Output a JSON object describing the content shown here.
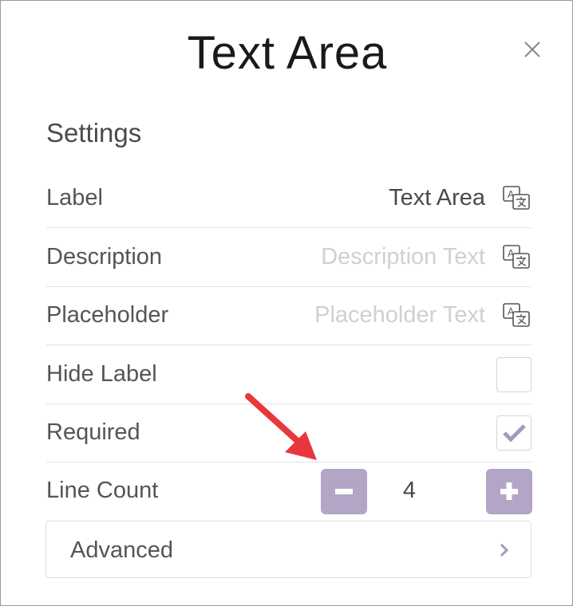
{
  "dialog": {
    "title": "Text Area",
    "section_heading": "Settings"
  },
  "rows": [
    {
      "label": "Label",
      "value": "Text Area",
      "value_is_placeholder": false
    },
    {
      "label": "Description",
      "value": "Description Text",
      "value_is_placeholder": true
    },
    {
      "label": "Placeholder",
      "value": "Placeholder Text",
      "value_is_placeholder": true
    }
  ],
  "hide_label": {
    "label": "Hide Label",
    "checked": false
  },
  "required": {
    "label": "Required",
    "checked": true
  },
  "line_count": {
    "label": "Line Count",
    "value": "4"
  },
  "advanced": {
    "label": "Advanced"
  },
  "colors": {
    "accent": "#b3a5c6",
    "annotation_arrow": "#e8383d",
    "placeholder_text": "#d0d0d0"
  },
  "icons": [
    "close-icon",
    "translate-icon",
    "checkmark-icon",
    "minus-icon",
    "plus-icon",
    "chevron-right-icon"
  ]
}
